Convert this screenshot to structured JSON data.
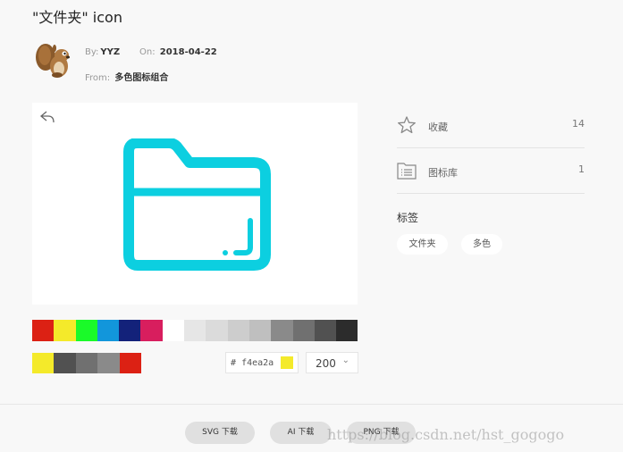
{
  "title": "\"文件夹\" icon",
  "meta": {
    "by_label": "By:",
    "by_value": "YYZ",
    "on_label": "On:",
    "on_value": "2018-04-22",
    "from_label": "From:",
    "from_value": "多色图标组合"
  },
  "preview": {
    "icon_name": "folder-icon",
    "icon_color": "#0ccfe0"
  },
  "palette": [
    "#dc2114",
    "#f4ea2a",
    "#1afa29",
    "#1296db",
    "#13227a",
    "#d81e5e",
    "#ffffff",
    "#e6e6e6",
    "#dbdbdb",
    "#cdcdcd",
    "#bfbfbf",
    "#8a8a8a",
    "#707070",
    "#515151",
    "#2c2c2c"
  ],
  "recent_colors": [
    "#f4ea2a",
    "#515151",
    "#707070",
    "#8a8a8a",
    "#dc2114"
  ],
  "color_input": {
    "prefix": "#",
    "value": "f4ea2a",
    "chip_color": "#f4ea2a"
  },
  "size_select": {
    "value": "200",
    "caret": "⌄"
  },
  "stats": [
    {
      "icon": "star-icon",
      "label": "收藏",
      "count": "14"
    },
    {
      "icon": "icon-library-icon",
      "label": "图标库",
      "count": "1"
    }
  ],
  "tags": {
    "title": "标签",
    "items": [
      "文件夹",
      "多色"
    ]
  },
  "downloads": {
    "svg": "SVG 下载",
    "ai": "AI 下载",
    "png": "PNG 下载"
  },
  "watermark": "https://blog.csdn.net/hst_gogogo"
}
